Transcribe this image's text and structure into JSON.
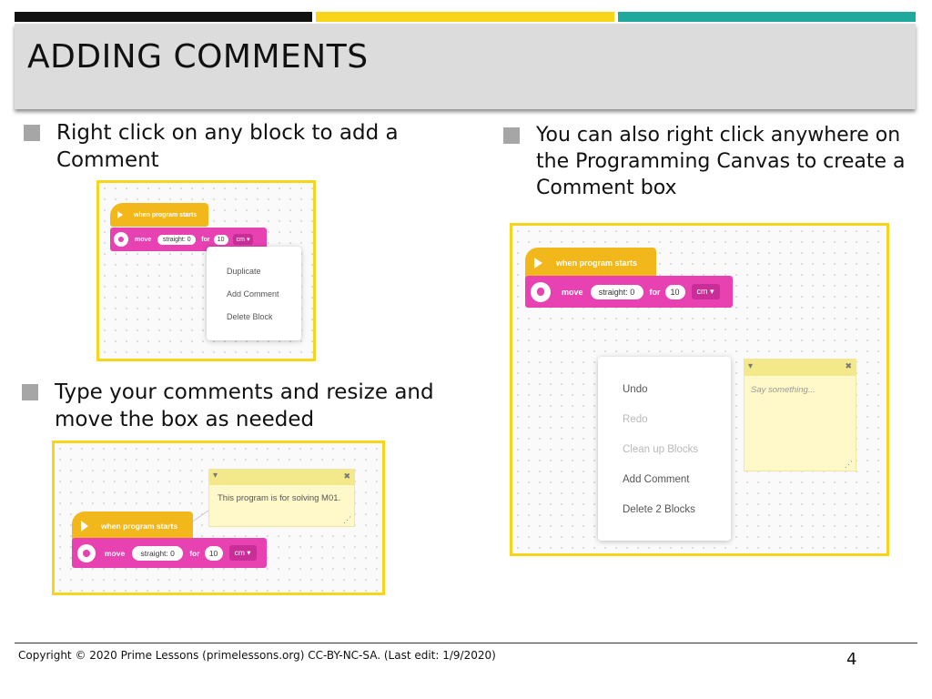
{
  "title": "ADDING COMMENTS",
  "bullets": {
    "b1": "Right click on any block to add a Comment",
    "b2": "You can also right click anywhere on the Programming Canvas to create a Comment box",
    "b3": "Type your comments and resize and move the box as needed"
  },
  "blocks": {
    "hat_label": "when program starts",
    "move_label": "move",
    "direction_value": "straight: 0",
    "for_label": "for",
    "amount_value": "10",
    "unit_value": "cm"
  },
  "block_menu": {
    "items": [
      "Duplicate",
      "Add Comment",
      "Delete Block"
    ]
  },
  "canvas_menu": {
    "items": [
      {
        "label": "Undo",
        "enabled": true
      },
      {
        "label": "Redo",
        "enabled": false
      },
      {
        "label": "Clean up Blocks",
        "enabled": false
      },
      {
        "label": "Add Comment",
        "enabled": true
      },
      {
        "label": "Delete 2 Blocks",
        "enabled": true
      }
    ]
  },
  "comment_empty": {
    "placeholder": "Say something..."
  },
  "comment_filled": {
    "text": "This program is for solving M01."
  },
  "icons": {
    "collapse": "▾",
    "close": "✖",
    "dropdown": "▾",
    "resize": "⋰"
  },
  "footer": {
    "copyright": "Copyright © 2020 Prime Lessons (primelessons.org) CC-BY-NC-SA.  (Last edit: 1/9/2020)",
    "page_number": "4"
  },
  "colors": {
    "accent_yellow": "#f9d51a",
    "accent_teal": "#1ea99c",
    "block_yellow": "#f2b71b",
    "block_pink": "#e841b2"
  }
}
